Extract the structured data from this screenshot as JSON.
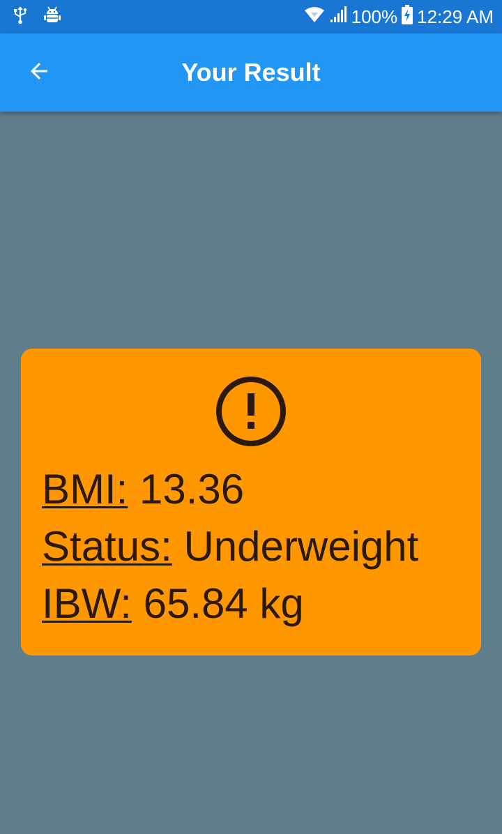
{
  "status_bar": {
    "battery_percent": "100%",
    "time": "12:29 AM",
    "icons": [
      "usb-icon",
      "android-debug-icon",
      "wifi-icon",
      "signal-icon",
      "battery-charging-icon"
    ]
  },
  "app_bar": {
    "title": "Your Result",
    "back_icon": "arrow-back-icon"
  },
  "result_card": {
    "icon": "error-outline-icon",
    "bmi_label": "BMI:",
    "bmi_value": "13.36",
    "status_label": "Status:",
    "status_value": "Underweight",
    "ibw_label": "IBW:",
    "ibw_value": "65.84 kg"
  },
  "colors": {
    "status_bar": "#1976d2",
    "app_bar": "#2196f3",
    "background": "#607d8b",
    "card": "#ff9800",
    "card_text": "#2b1a0b"
  }
}
